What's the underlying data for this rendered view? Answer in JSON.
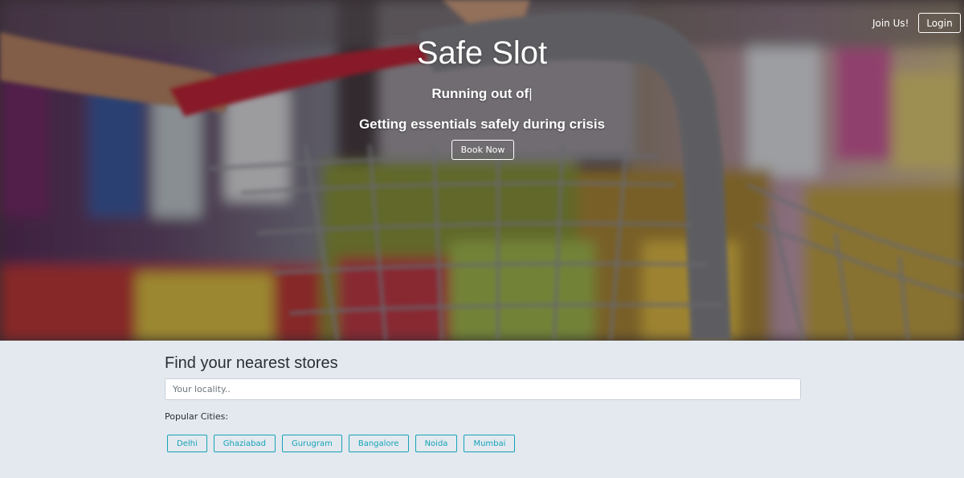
{
  "nav": {
    "join_label": "Join Us!",
    "login_label": "Login"
  },
  "hero": {
    "title": "Safe Slot",
    "typed_text": "Running out of",
    "typed_cursor": "|",
    "subtitle": "Getting essentials safely during crisis",
    "book_label": "Book Now"
  },
  "finder": {
    "title": "Find your nearest stores",
    "search_placeholder": "Your locality..",
    "popular_label": "Popular Cities:",
    "cities": [
      "Delhi",
      "Ghaziabad",
      "Gurugram",
      "Bangalore",
      "Noida",
      "Mumbai"
    ]
  },
  "colors": {
    "accent": "#17a2b8",
    "finder_bg": "#e3e9ef"
  }
}
